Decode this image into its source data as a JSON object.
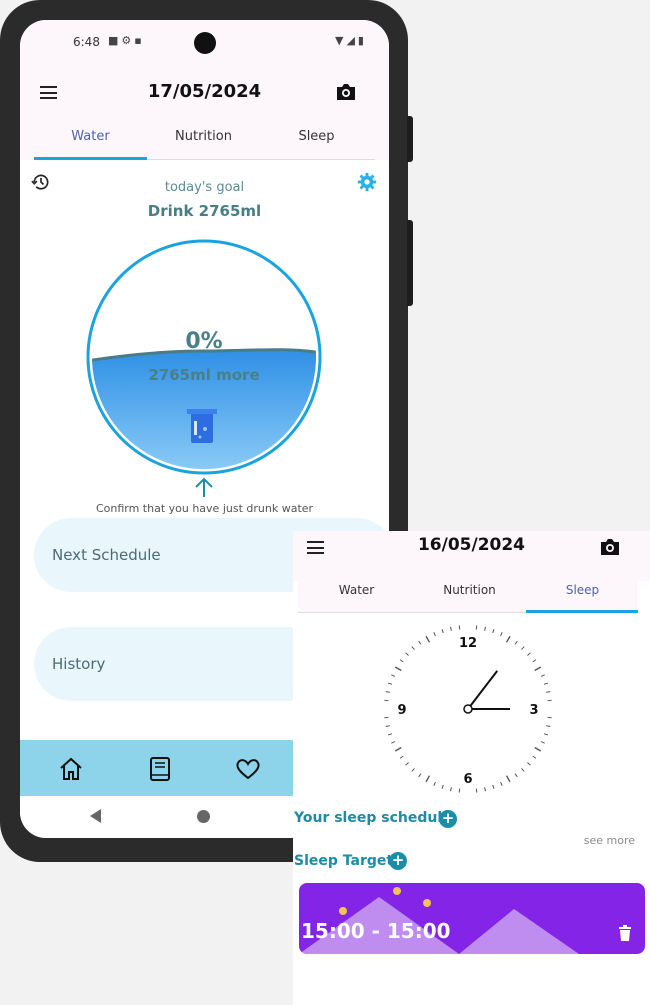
{
  "status_bar": {
    "time": "6:48"
  },
  "main": {
    "title": "17/05/2024",
    "tabs": [
      {
        "label": "Water",
        "active": true
      },
      {
        "label": "Nutrition",
        "active": false
      },
      {
        "label": "Sleep",
        "active": false
      }
    ],
    "goal_label": "today's goal",
    "goal_value": "Drink 2765ml",
    "progress_percent_text": "0%",
    "progress_fraction": 0,
    "remaining_text": "2765ml more",
    "confirm_text": "Confirm that you have just drunk water",
    "cards": [
      {
        "label": "Next Schedule"
      },
      {
        "label": "History"
      }
    ],
    "bottom_nav": [
      "home-icon",
      "book-icon",
      "heart-icon"
    ]
  },
  "panel": {
    "title": "16/05/2024",
    "tabs": [
      {
        "label": "Water",
        "active": false
      },
      {
        "label": "Nutrition",
        "active": false
      },
      {
        "label": "Sleep",
        "active": true
      }
    ],
    "clock": {
      "numbers": [
        "12",
        "3",
        "6",
        "9"
      ],
      "hour": 1,
      "minute": 15
    },
    "sleep_schedule_label": "Your sleep schedule",
    "see_more": "see more",
    "sleep_target_label": "Sleep Target",
    "target_time": "15:00 - 15:00"
  },
  "colors": {
    "accent": "#1ba2e0",
    "water": "#2a95e8",
    "card": "#e9f6fc",
    "nav": "#8dd3ea",
    "sleep_card": "#8424e6",
    "teal_text": "#1d8ba6"
  }
}
